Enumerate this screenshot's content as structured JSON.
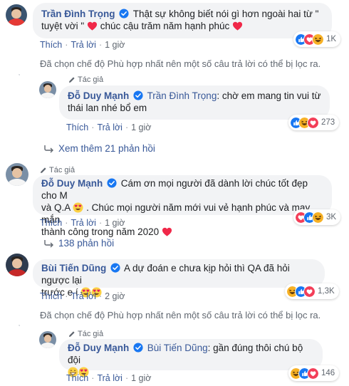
{
  "comments": [
    {
      "author": "Trần Đình Trọng",
      "text_part1": "Thật sự không biết nói gì hơn ngoài hai từ \"",
      "text_part2": "tuyệt vời \"",
      "text_part3": "chúc cậu trăm năm hạnh phúc",
      "actions": {
        "like": "Thích",
        "reply": "Trả lời",
        "time": "1 giờ"
      },
      "reaction_count": "1K",
      "reactions": [
        "like",
        "love",
        "haha"
      ]
    },
    {
      "notice": "Đã chọn chế độ Phù hợp nhất nên một số câu trả lời có thể bị lọc ra."
    },
    {
      "author_badge": "Tác giả",
      "author": "Đỗ Duy Mạnh",
      "mention": "Trần Đình Trọng",
      "text_part1": ": chờ em mang tin vui từ",
      "text_part2": "thái lan nhé bổ em",
      "actions": {
        "like": "Thích",
        "reply": "Trả lời",
        "time": "1 giờ"
      },
      "reaction_count": "273",
      "reactions": [
        "like",
        "haha",
        "love"
      ]
    },
    {
      "more": "Xem thêm 21 phản hồi"
    },
    {
      "author_badge": "Tác giả",
      "author": "Đỗ Duy Mạnh",
      "text_part1": "Cám ơn mọi người đã dành lời chúc tốt đẹp cho M",
      "text_part2": "và Q.A",
      "text_part3": ". Chúc mọi người năm mới vui vẻ hạnh phúc và may mắn",
      "text_part4": "thành công trong năm 2020",
      "actions": {
        "like": "Thích",
        "reply": "Trả lời",
        "time": "1 giờ"
      },
      "reaction_count": "3K",
      "reactions": [
        "love",
        "like",
        "haha"
      ]
    },
    {
      "more": "138 phản hồi"
    },
    {
      "author": "Bùi Tiến Dũng",
      "text_part1": "A dự đoán e chưa kịp hỏi thì QA đã hỏi ngược lại",
      "text_part2": "trước e í",
      "actions": {
        "like": "Thích",
        "reply": "Trả lời",
        "time": "2 giờ"
      },
      "reaction_count": "1,3K",
      "reactions": [
        "haha",
        "like",
        "love"
      ]
    },
    {
      "notice": "Đã chọn chế độ Phù hợp nhất nên một số câu trả lời có thể bị lọc ra."
    },
    {
      "author_badge": "Tác giả",
      "author": "Đỗ Duy Mạnh",
      "mention": "Bùi Tiến Dũng",
      "text_part1": ": gần đúng thôi chú bộ đội",
      "actions": {
        "like": "Thích",
        "reply": "Trả lời",
        "time": "1 giờ"
      },
      "reaction_count": "146",
      "reactions": [
        "haha",
        "like",
        "love"
      ]
    }
  ],
  "colors": {
    "link": "#385898",
    "bubble": "#f2f3f5",
    "meta": "#606770",
    "like": "#1877f2",
    "love": "#f33e58",
    "haha": "#f7b125"
  }
}
